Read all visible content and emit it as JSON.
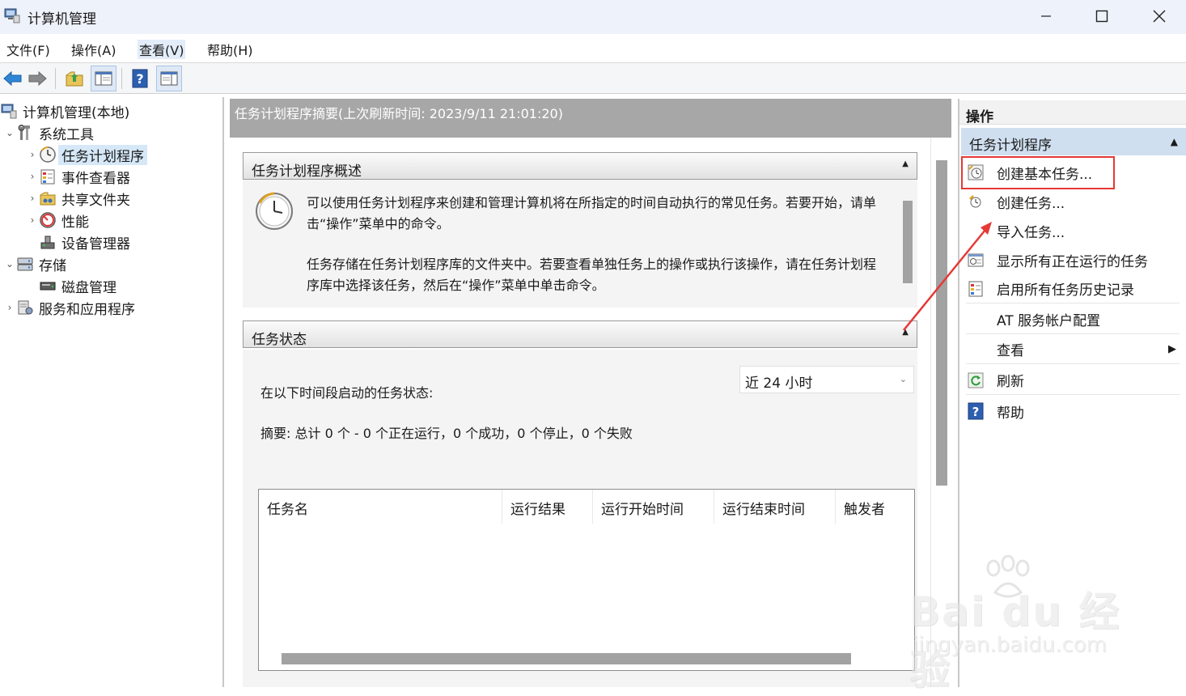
{
  "window": {
    "title": "计算机管理"
  },
  "menu": [
    "文件(F)",
    "操作(A)",
    "查看(V)",
    "帮助(H)"
  ],
  "tree": {
    "root": "计算机管理(本地)",
    "system_tools": "系统工具",
    "task_scheduler": "任务计划程序",
    "event_viewer": "事件查看器",
    "shared_folders": "共享文件夹",
    "performance": "性能",
    "device_manager": "设备管理器",
    "storage": "存储",
    "disk_management": "磁盘管理",
    "services_apps": "服务和应用程序"
  },
  "middle": {
    "header": "任务计划程序摘要(上次刷新时间: 2023/9/11 21:01:20)",
    "overview_title": "任务计划程序概述",
    "overview_p1": "可以使用任务计划程序来创建和管理计算机将在所指定的时间自动执行的常见任务。若要开始，请单击“操作”菜单中的命令。",
    "overview_p2": "任务存储在任务计划程序库的文件夹中。若要查看单独任务上的操作或执行该操作，请在任务计划程序库中选择该任务，然后在“操作”菜单中单击命令。",
    "status_title": "任务状态",
    "status_label": "在以下时间段启动的任务状态:",
    "range_value": "近 24 小时",
    "summary": "摘要: 总计 0 个 - 0 个正在运行，0 个成功，0 个停止，0 个失败",
    "columns": [
      "任务名",
      "运行结果",
      "运行开始时间",
      "运行结束时间",
      "触发者"
    ]
  },
  "actions": {
    "title": "操作",
    "group": "任务计划程序",
    "items": [
      "创建基本任务...",
      "创建任务...",
      "导入任务...",
      "显示所有正在运行的任务",
      "启用所有任务历史记录",
      "AT 服务帐户配置",
      "查看",
      "刷新",
      "帮助"
    ]
  },
  "watermark": {
    "brand": "Bai du 经验",
    "url": "jingyan.baidu.com"
  },
  "colors": {
    "highlight": "#e53935",
    "header_gray": "#a7a7a7",
    "group_blue": "#cfdff0"
  }
}
